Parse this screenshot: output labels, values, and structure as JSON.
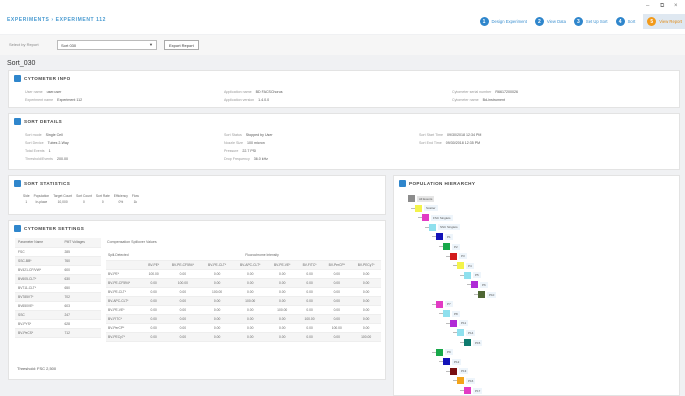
{
  "breadcrumb": "EXPERIMENTS › EXPERIMENT 112",
  "window_controls": {
    "minimize": "–",
    "restore": "⧉",
    "close": "×"
  },
  "steps": [
    {
      "num": "1",
      "label": "Design Experiment"
    },
    {
      "num": "2",
      "label": "View Data"
    },
    {
      "num": "3",
      "label": "Set Up Sort"
    },
    {
      "num": "4",
      "label": "Sort"
    },
    {
      "num": "5",
      "label": "View Report"
    }
  ],
  "select_row": {
    "label": "Select by Report",
    "value": "Sort 030",
    "button": "Export Report"
  },
  "sort_name": "Sort_030",
  "cytometer_info": {
    "title": "CYTOMETER INFO",
    "fields": [
      {
        "k": "User name",
        "v": "user.user"
      },
      {
        "k": "Experiment name",
        "v": "Experiment 112"
      },
      {
        "k": "Application name",
        "v": "BD FACSChorus"
      },
      {
        "k": "Application version",
        "v": "1.4.0.0"
      },
      {
        "k": "Cytometer serial number",
        "v": "R6617200026"
      },
      {
        "k": "Cytometer name",
        "v": "Bd-instrument"
      }
    ]
  },
  "sort_details": {
    "title": "SORT DETAILS",
    "fields": [
      {
        "k": "Sort mode",
        "v": "Single Cell"
      },
      {
        "k": "Sort Device",
        "v": "Tubes 2-Way"
      },
      {
        "k": "Total Events",
        "v": "1"
      },
      {
        "k": "Threshold/Events",
        "v": "200.00"
      },
      {
        "k": "Sort Status",
        "v": "Stopped by User"
      },
      {
        "k": "Nozzle Size",
        "v": "100 micron"
      },
      {
        "k": "Pressure",
        "v": "22.7 PSI"
      },
      {
        "k": "Drop Frequency",
        "v": "36.0 kHz"
      },
      {
        "k": "Sort Start Time",
        "v": "09/30/2018 12:34 PM"
      },
      {
        "k": "Sort End Time",
        "v": "09/30/2018 12:35 PM"
      }
    ]
  },
  "sort_statistics": {
    "title": "SORT STATISTICS",
    "headers": [
      "Side",
      "Population",
      "Target Count",
      "Sort Count",
      "Sort Rate",
      "Efficiency",
      "Flow"
    ],
    "row": [
      "1",
      "In-place",
      "10,000",
      "0",
      "0",
      "0%",
      "1k"
    ]
  },
  "cytometer_settings": {
    "title": "CYTOMETER SETTINGS",
    "param_headers": [
      "Parameter Name",
      "PMT Voltages"
    ],
    "params": [
      [
        "FSC",
        "285"
      ],
      [
        "SSC-BB*",
        "760"
      ],
      [
        "BV421-CP/VW*",
        "600"
      ],
      [
        "BV605-CLT*",
        "630"
      ],
      [
        "BV711-CLT*",
        "650"
      ],
      [
        "BV785VT*",
        "702"
      ],
      [
        "BV650VE*",
        "603"
      ],
      [
        "SSC",
        "247"
      ],
      [
        "BV-PYS*",
        "628"
      ],
      [
        "BV-PeCS*",
        "712"
      ]
    ],
    "threshold": "Threshold: FSC 2,500",
    "comp_title": "Compensation Spillover Values",
    "comp_header_group": "Fluorochrome Intensity",
    "comp_row_header": "Spill-Detected",
    "comp_cols": [
      "BV-PE*",
      "BV-PE-CF594*",
      "BV-PE-CLT*",
      "BV-APC-CLT*",
      "BV-PE-VE*",
      "BV-FITC*",
      "BV-PerCP*",
      "BV-PECy7*"
    ],
    "comp_rows": [
      [
        "BV-PE*",
        "100.00",
        "0.00",
        "0.00",
        "0.00",
        "0.00",
        "0.00",
        "0.00",
        "0.00"
      ],
      [
        "BV-PE-CF594*",
        "0.00",
        "100.00",
        "0.00",
        "0.00",
        "0.00",
        "0.00",
        "0.00",
        "0.00"
      ],
      [
        "BV-PE-CLT*",
        "0.00",
        "0.00",
        "100.00",
        "0.00",
        "0.00",
        "0.00",
        "0.00",
        "0.00"
      ],
      [
        "BV-APC-CLT*",
        "0.00",
        "0.00",
        "0.00",
        "100.00",
        "0.00",
        "0.00",
        "0.00",
        "0.00"
      ],
      [
        "BV-PE-VE*",
        "0.00",
        "0.00",
        "0.00",
        "0.00",
        "100.00",
        "0.00",
        "0.00",
        "0.00"
      ],
      [
        "BV-FITC*",
        "0.00",
        "0.00",
        "0.00",
        "0.00",
        "0.00",
        "100.00",
        "0.00",
        "0.00"
      ],
      [
        "BV-PerCP*",
        "0.00",
        "0.00",
        "0.00",
        "0.00",
        "0.00",
        "0.00",
        "100.00",
        "0.00"
      ],
      [
        "BV-PECy7*",
        "0.00",
        "0.00",
        "0.00",
        "0.00",
        "0.00",
        "0.00",
        "0.00",
        "100.00"
      ]
    ]
  },
  "population_hierarchy": {
    "title": "POPULATION HIERARCHY",
    "nodes": [
      {
        "label": "All Events",
        "color": "#8c8c8c"
      },
      {
        "label": "Scatter",
        "color": "#f3f34a"
      },
      {
        "label": "FSC Singlets",
        "color": "#e23bc4"
      },
      {
        "label": "SSC Singlets",
        "color": "#8fe0ee"
      },
      {
        "label": "P1",
        "color": "#1313b8"
      },
      {
        "label": "P2",
        "color": "#17a84a"
      },
      {
        "label": "P3",
        "color": "#d31c1c"
      },
      {
        "label": "P4",
        "color": "#f3f34a"
      },
      {
        "label": "P5",
        "color": "#8fe0ee"
      },
      {
        "label": "P6",
        "color": "#b02bd6"
      },
      {
        "label": "P10",
        "color": "#4e6633"
      },
      {
        "label": "P7",
        "color": "#e23bc4"
      },
      {
        "label": "P8",
        "color": "#8fe0ee"
      },
      {
        "label": "P11",
        "color": "#b02bd6"
      },
      {
        "label": "P14",
        "color": "#8fe0ee"
      },
      {
        "label": "P15",
        "color": "#0e7a6e"
      },
      {
        "label": "P9",
        "color": "#17a84a"
      },
      {
        "label": "P12",
        "color": "#1313b8"
      },
      {
        "label": "P13",
        "color": "#7a1010"
      },
      {
        "label": "P16",
        "color": "#f3a41a"
      },
      {
        "label": "P17",
        "color": "#e23bc4"
      }
    ]
  },
  "colors": {
    "accent": "#2f86cc",
    "active_step": "#f29a1a",
    "breadcrumb": "#4a9bd1"
  }
}
